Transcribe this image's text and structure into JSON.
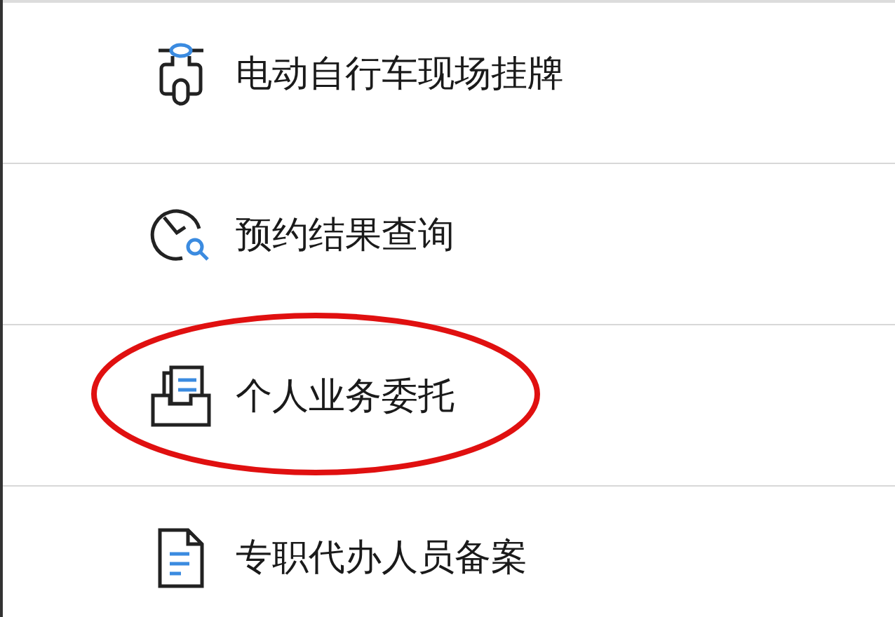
{
  "menu_items": [
    {
      "kind": "scooter",
      "label": "电动自行车现场挂牌",
      "circled": false
    },
    {
      "kind": "clock-search",
      "label": "预约结果查询",
      "circled": false
    },
    {
      "kind": "tray",
      "label": "个人业务委托",
      "circled": true
    },
    {
      "kind": "document",
      "label": "专职代办人员备案",
      "circled": false
    }
  ]
}
